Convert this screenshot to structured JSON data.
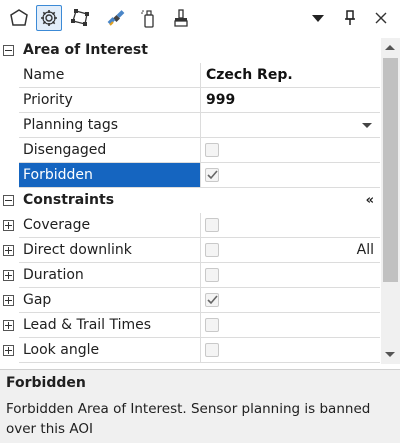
{
  "toolbar": {
    "icons": [
      "hexagon-icon",
      "gear-icon",
      "polygon-nodes-icon",
      "satellite-icon",
      "spray-can-icon",
      "brush-icon"
    ],
    "controls": [
      "dropdown-arrow-icon",
      "pin-icon",
      "close-icon"
    ]
  },
  "area_of_interest": {
    "title": "Area of Interest",
    "name_label": "Name",
    "name_value": "Czech Rep.",
    "priority_label": "Priority",
    "priority_value": "999",
    "planning_tags_label": "Planning tags",
    "planning_tags_value": "",
    "disengaged_label": "Disengaged",
    "disengaged_checked": false,
    "forbidden_label": "Forbidden",
    "forbidden_checked": true
  },
  "constraints": {
    "title": "Constraints",
    "collapse_glyph": "«",
    "items": [
      {
        "label": "Coverage",
        "checked": false,
        "extra": ""
      },
      {
        "label": "Direct downlink",
        "checked": false,
        "extra": "All"
      },
      {
        "label": "Duration",
        "checked": false,
        "extra": ""
      },
      {
        "label": "Gap",
        "checked": true,
        "extra": ""
      },
      {
        "label": "Lead & Trail Times",
        "checked": false,
        "extra": ""
      },
      {
        "label": "Look angle",
        "checked": false,
        "extra": ""
      }
    ]
  },
  "description": {
    "title": "Forbidden",
    "text": "Forbidden Area of Interest. Sensor planning is banned over this AOI"
  },
  "colors": {
    "selection": "#1565c0",
    "selected_icon_border": "#3c8ad6"
  }
}
